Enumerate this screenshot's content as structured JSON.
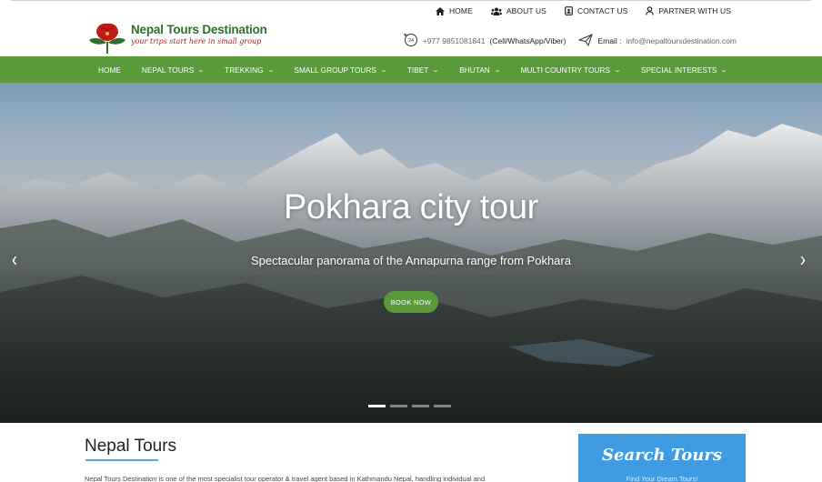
{
  "top_links": [
    {
      "label": "HOME",
      "icon": "home-icon"
    },
    {
      "label": "ABOUT US",
      "icon": "users-icon"
    },
    {
      "label": "CONTACT US",
      "icon": "contact-card-icon"
    },
    {
      "label": "PARTNER WITH US",
      "icon": "user-icon"
    }
  ],
  "logo": {
    "title": "Nepal Tours Destination",
    "tagline": "your trips start here in small group"
  },
  "contact": {
    "phone": "+977 9851081841",
    "phone_note": "(Cell/WhatsApp/Viber)",
    "email_label": "Email :",
    "email": "info@nepaltoursdestination.com"
  },
  "nav": [
    {
      "label": "HOME",
      "dropdown": false
    },
    {
      "label": "NEPAL TOURS",
      "dropdown": true
    },
    {
      "label": "TREKKING",
      "dropdown": true
    },
    {
      "label": "SMALL GROUP TOURS",
      "dropdown": true
    },
    {
      "label": "TIBET",
      "dropdown": true
    },
    {
      "label": "BHUTAN",
      "dropdown": true
    },
    {
      "label": "MULTI COUNTRY TOURS",
      "dropdown": true
    },
    {
      "label": "SPECIAL INTERESTS",
      "dropdown": true
    }
  ],
  "hero": {
    "title": "Pokhara city tour",
    "subtitle": "Spectacular panorama of the Annapurna range from Pokhara",
    "button": "BOOK NOW",
    "prev": "‹",
    "next": "›",
    "slide_count": 4,
    "active_slide": 1
  },
  "content": {
    "title": "Nepal Tours",
    "text": "Nepal Tours Destination is one of the most specialist tour operator & travel agent based in Kathmandu Nepal, handling individual and"
  },
  "search": {
    "title": "Search Tours",
    "subtitle": "Find Your Dream Tours!"
  },
  "colors": {
    "nav_green": "#5b9a3a",
    "search_blue": "#3f9be2",
    "logo_green": "#2f6e2f",
    "logo_red": "#c21a1a"
  }
}
